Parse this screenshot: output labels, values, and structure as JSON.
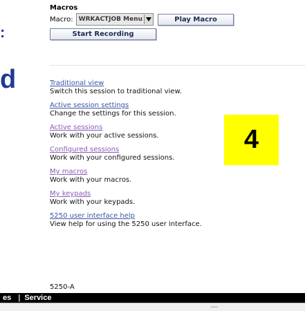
{
  "left_fragments": {
    "colon": ":",
    "d": "d"
  },
  "macros": {
    "title": "Macros",
    "macro_label": "Macro:",
    "selected_macro": "WRKACTJOB Menu",
    "play_label": "Play Macro",
    "record_label": "Start Recording"
  },
  "links": [
    {
      "title": "Traditional view",
      "desc": "Switch this session to traditional view."
    },
    {
      "title": "Active session settings",
      "desc": "Change the settings for this session."
    },
    {
      "title": "Active sessions",
      "desc": "Work with your active sessions."
    },
    {
      "title": "Configured sessions",
      "desc": "Work with your configured sessions."
    },
    {
      "title": "My macros",
      "desc": "Work with your macros."
    },
    {
      "title": "My keypads",
      "desc": "Work with your keypads."
    },
    {
      "title": "5250 user interface help",
      "desc": "View help for using the 5250 user interface."
    }
  ],
  "badge": {
    "number": "4",
    "color": "#ffff00"
  },
  "version": "5250-A",
  "bottom_bar": {
    "item1": "es",
    "item2": "Service"
  },
  "colors": {
    "link": "#3b57a6",
    "link_visited": "#8a5bb6",
    "heading": "#1f3a93"
  }
}
